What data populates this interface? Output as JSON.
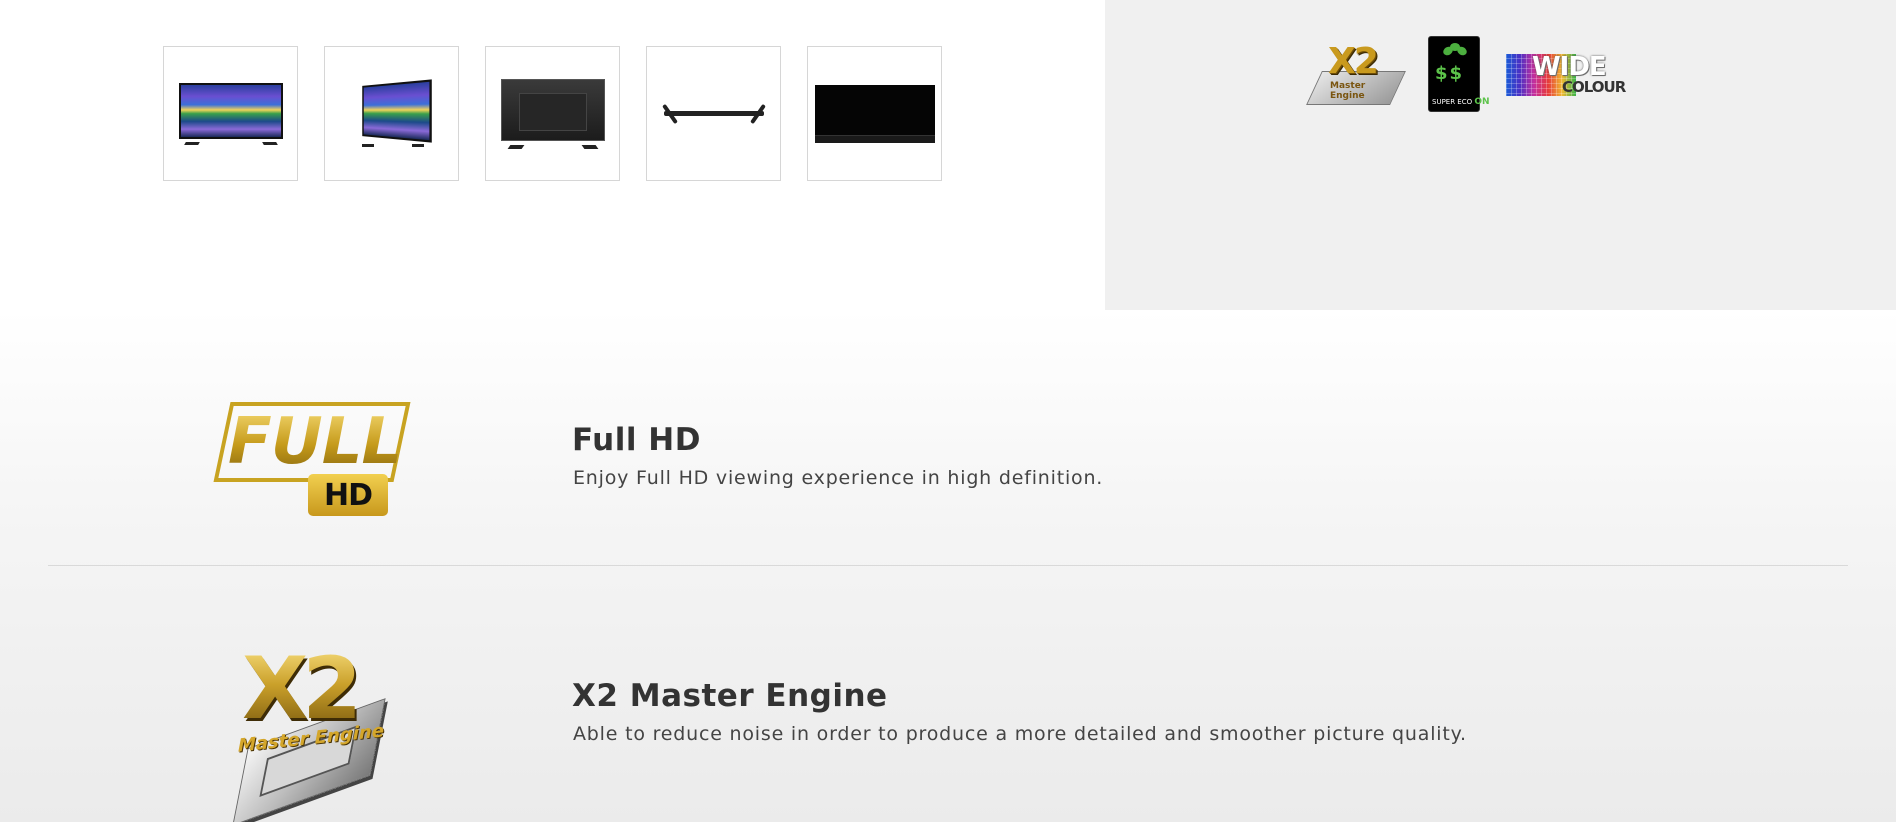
{
  "gallery": {
    "thumbnails": [
      {
        "view": "front"
      },
      {
        "view": "angled"
      },
      {
        "view": "back"
      },
      {
        "view": "top-stand"
      },
      {
        "view": "bottom-edge"
      }
    ]
  },
  "badges": {
    "x2": {
      "icon": "x2-master-engine-badge",
      "main": "X2",
      "sub": "Master Engine"
    },
    "eco": {
      "icon": "super-eco-badge",
      "symbols": "$$",
      "caption": "SUPER ECO",
      "state": "ON"
    },
    "wide": {
      "icon": "wide-colour-badge",
      "line1": "WIDE",
      "line2": "COLOUR"
    }
  },
  "features": [
    {
      "icon": "full-hd-logo",
      "logo_main": "FULL",
      "logo_sub": "HD",
      "title": "Full HD",
      "description": "Enjoy Full HD viewing experience in high definition."
    },
    {
      "icon": "x2-master-engine-logo",
      "logo_main": "X2",
      "logo_sub": "Master Engine",
      "title": "X2 Master Engine",
      "description": "Able to reduce noise in order to produce a more detailed and smoother picture quality."
    }
  ],
  "colors": {
    "gold": "#c9a526",
    "panel_bg": "#f0f0f0",
    "text": "#333333"
  }
}
